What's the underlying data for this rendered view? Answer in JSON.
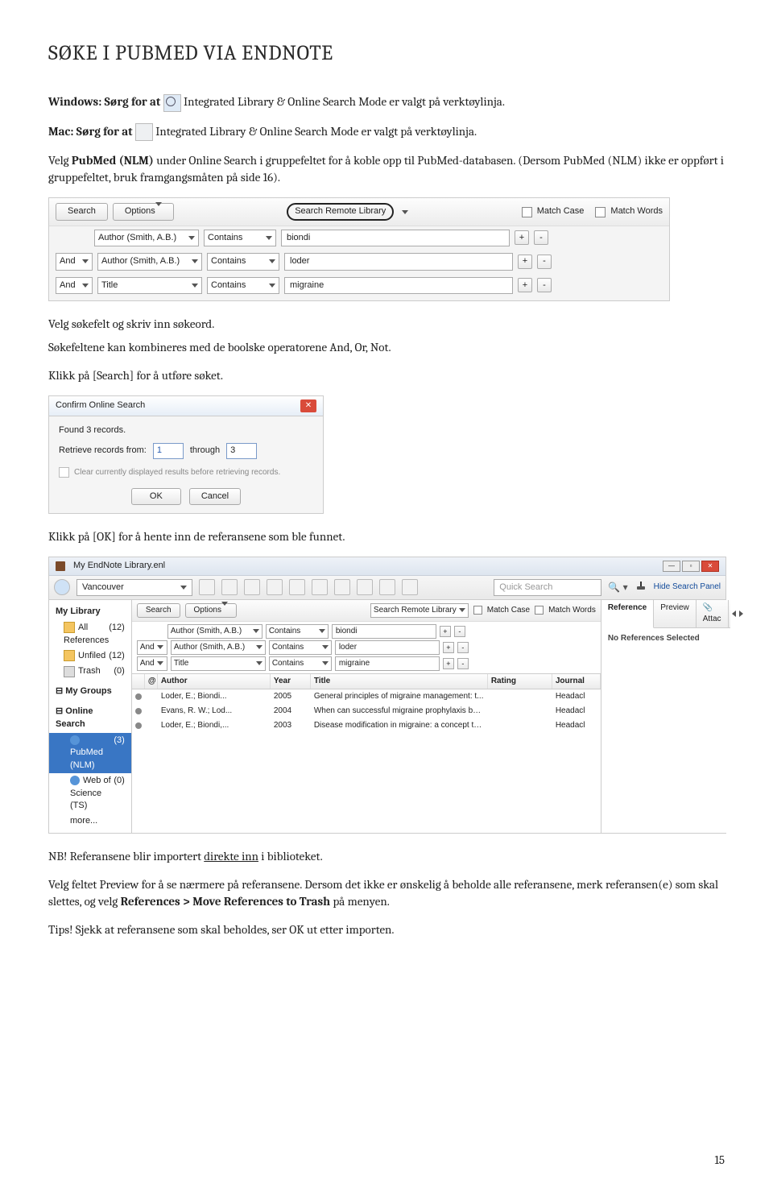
{
  "title": "SØKE I PUBMED VIA ENDNOTE",
  "para1_a": "Windows: Sørg for at ",
  "para1_b": " Integrated Library & Online Search Mode er valgt på verktøylinja.",
  "para2_a": "Mac: Sørg for at ",
  "para2_b": " Integrated Library & Online Search Mode er valgt på verktøylinja.",
  "para3": "Velg PubMed (NLM) under Online Search i gruppefeltet for å koble opp til PubMed-databasen. (Dersom PubMed (NLM) ikke er oppført i gruppefeltet, bruk framgangsmåten på side 16).",
  "ss1": {
    "btn_search": "Search",
    "btn_options": "Options",
    "search_remote": "Search Remote Library",
    "match_case": "Match Case",
    "match_words": "Match Words",
    "rows": [
      {
        "op": "",
        "field": "Author (Smith, A.B.)",
        "cond": "Contains",
        "val": "biondi"
      },
      {
        "op": "And",
        "field": "Author (Smith, A.B.)",
        "cond": "Contains",
        "val": "loder"
      },
      {
        "op": "And",
        "field": "Title",
        "cond": "Contains",
        "val": "migraine"
      }
    ]
  },
  "para4": "Velg søkefelt og skriv inn søkeord.",
  "para5": "Søkefeltene kan kombineres med de boolske operatorene And, Or, Not.",
  "para6": "Klikk på [Search] for å utføre søket.",
  "ss2": {
    "title": "Confirm Online Search",
    "found": "Found 3 records.",
    "retrieve": "Retrieve records from:",
    "from": "1",
    "through_label": "through",
    "through": "3",
    "clear": "Clear currently displayed results before retrieving records.",
    "ok": "OK",
    "cancel": "Cancel"
  },
  "para7": "Klikk på [OK] for å hente inn de referansene som ble funnet.",
  "ss3": {
    "win_title": "My EndNote Library.enl",
    "style": "Vancouver",
    "quick": "Quick Search",
    "hide": "Hide Search Panel",
    "side": {
      "mylib": "My Library",
      "all": "All References",
      "all_n": "(12)",
      "unfiled": "Unfiled",
      "unfiled_n": "(12)",
      "trash": "Trash",
      "trash_n": "(0)",
      "groups": "My Groups",
      "online": "Online Search",
      "pubmed": "PubMed (NLM)",
      "pubmed_n": "(3)",
      "wos": "Web of Science (TS)",
      "wos_n": "(0)",
      "more": "more..."
    },
    "mini": {
      "search": "Search",
      "options": "Options",
      "remote": "Search Remote Library",
      "mcase": "Match Case",
      "mwords": "Match Words",
      "rows": [
        {
          "op": "",
          "field": "Author (Smith, A.B.)",
          "cond": "Contains",
          "val": "biondi"
        },
        {
          "op": "And",
          "field": "Author (Smith, A.B.)",
          "cond": "Contains",
          "val": "loder"
        },
        {
          "op": "And",
          "field": "Title",
          "cond": "Contains",
          "val": "migraine"
        }
      ]
    },
    "cols": {
      "author": "Author",
      "year": "Year",
      "title": "Title",
      "rating": "Rating",
      "journal": "Journal"
    },
    "results": [
      {
        "author": "Loder, E.; Biondi...",
        "year": "2005",
        "title": "General principles of migraine management: t...",
        "journal": "Headacl"
      },
      {
        "author": "Evans, R. W.; Lod...",
        "year": "2004",
        "title": "When can successful migraine prophylaxis be d...",
        "journal": "Headacl"
      },
      {
        "author": "Loder, E.; Biondi,...",
        "year": "2003",
        "title": "Disease modification in migraine: a concept th...",
        "journal": "Headacl"
      }
    ],
    "tabs": {
      "ref": "Reference",
      "prev": "Preview",
      "att": "Attac"
    },
    "noref": "No References Selected"
  },
  "para8_a": "NB! Referansene blir importert ",
  "para8_b": "direkte inn",
  "para8_c": " i biblioteket.",
  "para9_a": "Velg feltet Preview for å se nærmere på referansene. Dersom det ikke er ønskelig å beholde alle referansene, merk referansen(e) som skal slettes, og velg ",
  "para9_b": "References > Move References to Trash",
  "para9_c": " på menyen.",
  "para10": "Tips! Sjekk at referansene som skal beholdes, ser OK ut etter importen.",
  "page_num": "15"
}
